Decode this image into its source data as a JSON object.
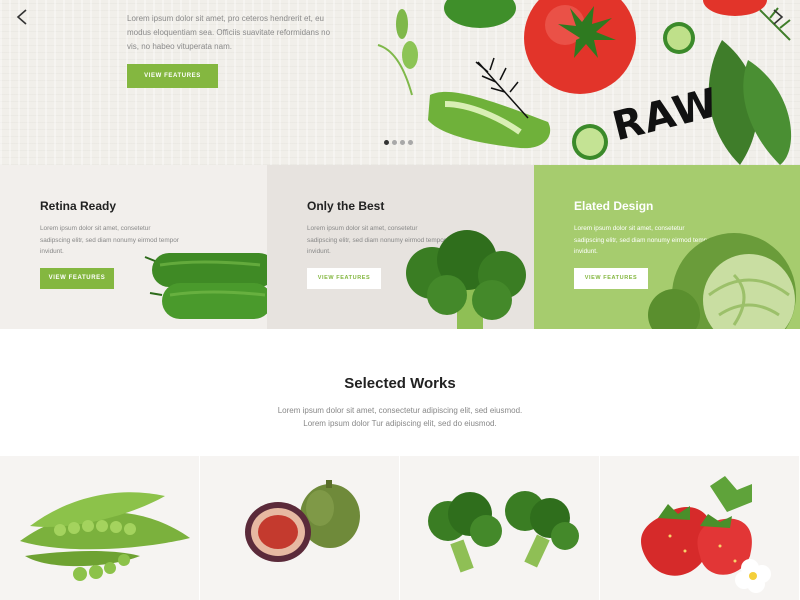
{
  "hero": {
    "text": "Lorem ipsum dolor sit amet, pro ceteros hendrerit et, eu modus eloquentiam sea. Officiis suavitate reformidans no vis, no habeo vituperata nam.",
    "button_label": "VIEW FEATURES",
    "raw_text": "RAW",
    "slide_dots": 4,
    "active_dot": 1
  },
  "features": [
    {
      "title": "Retina Ready",
      "text": "Lorem ipsum dolor sit amet, consetetur sadipscing elitr, sed diam nonumy eirmod tempor invidunt.",
      "button_label": "VIEW FEATURES"
    },
    {
      "title": "Only the Best",
      "text": "Lorem ipsum dolor sit amet, consetetur sadipscing elitr, sed diam nonumy eirmod tempor invidunt.",
      "button_label": "VIEW FEATURES"
    },
    {
      "title": "Elated Design",
      "text": "Lorem ipsum dolor sit amet, consetetur sadipscing elitr, sed diam nonumy eirmod tempor invidunt.",
      "button_label": "VIEW FEATURES"
    }
  ],
  "selected_works": {
    "title": "Selected Works",
    "text_line1": "Lorem ipsum dolor sit amet, consectetur adipiscing elit, sed eiusmod.",
    "text_line2": "Lorem ipsum dolor Tur adipiscing elit, sed do eiusmod."
  },
  "icons": {
    "prev": "chevron-left-icon",
    "next": "chevron-right-icon"
  },
  "colors": {
    "accent": "#84b740",
    "feature_green": "#a6cc6e",
    "feature_light": "#f2efec",
    "feature_mid": "#e7e3df"
  }
}
